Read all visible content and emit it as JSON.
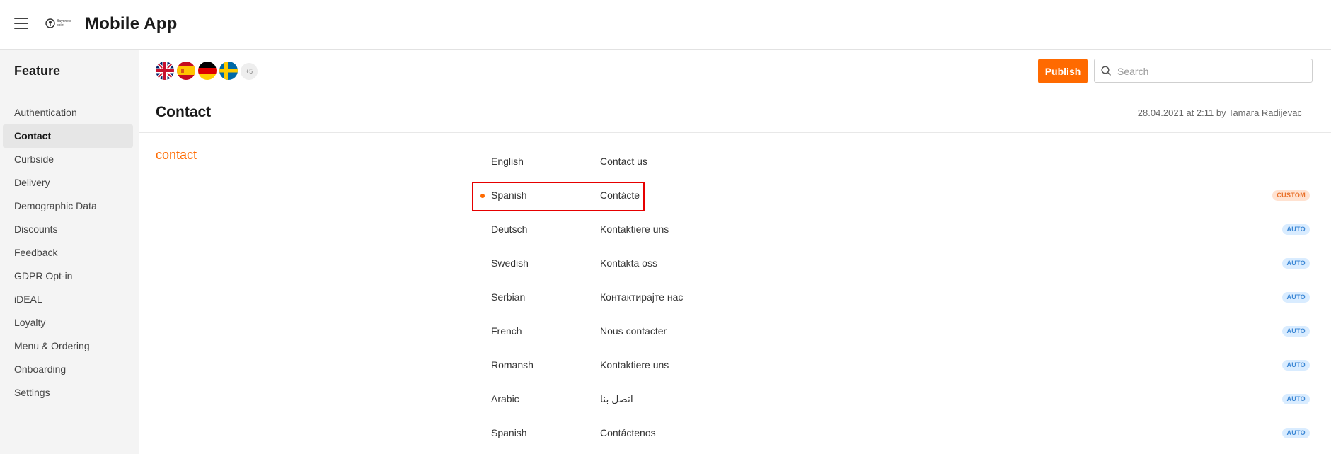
{
  "header": {
    "title": "Mobile App",
    "logo_text_line1": "Bayonets",
    "logo_text_line2": "point"
  },
  "sidebar": {
    "heading": "Feature",
    "items": [
      {
        "label": "Authentication"
      },
      {
        "label": "Contact",
        "active": true
      },
      {
        "label": "Curbside"
      },
      {
        "label": "Delivery"
      },
      {
        "label": "Demographic Data"
      },
      {
        "label": "Discounts"
      },
      {
        "label": "Feedback"
      },
      {
        "label": "GDPR Opt-in"
      },
      {
        "label": "iDEAL"
      },
      {
        "label": "Loyalty"
      },
      {
        "label": "Menu & Ordering"
      },
      {
        "label": "Onboarding"
      },
      {
        "label": "Settings"
      }
    ]
  },
  "toolbar": {
    "flags": [
      "uk-flag-icon",
      "spain-flag-icon",
      "germany-flag-icon",
      "sweden-flag-icon"
    ],
    "more_flags_label": "+5",
    "publish_label": "Publish",
    "search_placeholder": "Search"
  },
  "content": {
    "title": "Contact",
    "meta": "28.04.2021 at 2:11 by Tamara Radijevac",
    "key_name": "contact",
    "translations": [
      {
        "language": "English",
        "value": "Contact us",
        "badge": ""
      },
      {
        "language": "Spanish",
        "value": "Contácte",
        "badge": "CUSTOM"
      },
      {
        "language": "Deutsch",
        "value": "Kontaktiere uns",
        "badge": "AUTO"
      },
      {
        "language": "Swedish",
        "value": "Kontakta oss",
        "badge": "AUTO"
      },
      {
        "language": "Serbian",
        "value": "Контактирајте нас",
        "badge": "AUTO"
      },
      {
        "language": "French",
        "value": "Nous contacter",
        "badge": "AUTO"
      },
      {
        "language": "Romansh",
        "value": "Kontaktiere uns",
        "badge": "AUTO"
      },
      {
        "language": "Arabic",
        "value": "اتصل بنا",
        "badge": "AUTO"
      },
      {
        "language": "Spanish",
        "value": "Contáctenos",
        "badge": "AUTO"
      }
    ]
  },
  "colors": {
    "accent": "#ff6a00",
    "highlight": "#e60000",
    "auto_badge": "#3a86d4",
    "custom_badge": "#e8702a"
  }
}
